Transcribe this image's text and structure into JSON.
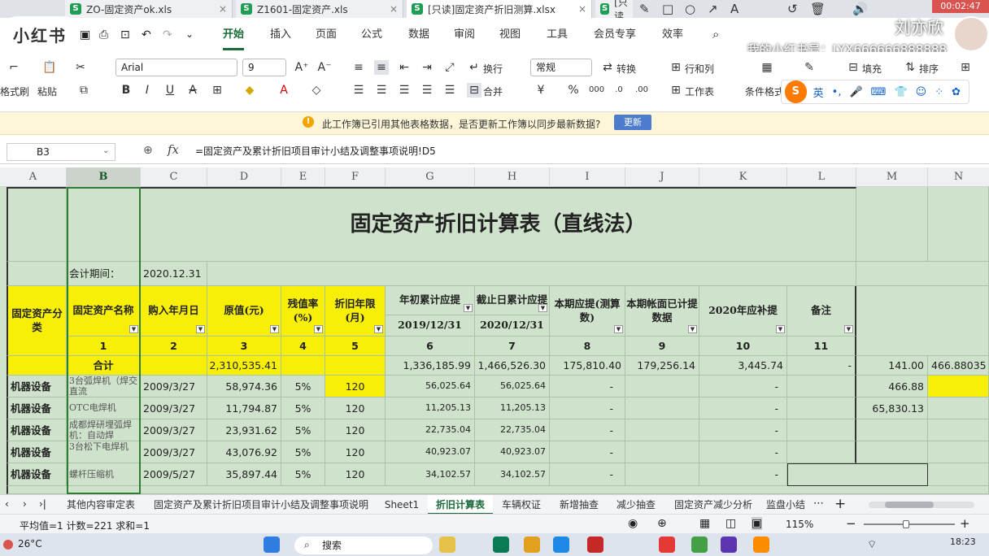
{
  "file_tabs": [
    {
      "label": "ZO-固定资产ok.xls",
      "active": false
    },
    {
      "label": "Z1601-固定资产.xls",
      "active": false
    },
    {
      "label": "[只读]固定资产折旧测算.xlsx",
      "active": true
    },
    {
      "label": "[只读",
      "active": false
    }
  ],
  "record_time": "00:02:47",
  "watermark": {
    "logo": "小红书",
    "name": "刘亦欣",
    "id": "我的小红书号：LYX666666888888"
  },
  "menu_tabs": [
    "开始",
    "插入",
    "页面",
    "公式",
    "数据",
    "审阅",
    "视图",
    "工具",
    "会员专享",
    "效率"
  ],
  "toolbar": {
    "format_painter": "格式刷",
    "paste": "粘贴",
    "font_name": "Arial",
    "font_size": "9",
    "wrap": "换行",
    "number_format": "常规",
    "convert": "转换",
    "rowcol": "行和列",
    "fill": "填充",
    "sort": "排序",
    "merge": "合并",
    "worksheet": "工作表",
    "cond_format": "条件格式",
    "ime": "英"
  },
  "notice": {
    "text": "此工作簿已引用其他表格数据，是否更新工作簿以同步最新数据?",
    "button": "更新"
  },
  "formula_bar": {
    "name_box": "B3",
    "formula": "=固定资产及累计折旧项目审计小结及调整事项说明!D5"
  },
  "columns": [
    "A",
    "B",
    "C",
    "D",
    "E",
    "F",
    "G",
    "H",
    "I",
    "J",
    "K",
    "L",
    "M",
    "N"
  ],
  "sheet": {
    "title": "固定资产折旧计算表（直线法）",
    "period_label": "会计期间：",
    "period_value": "2020.12.31",
    "headers": {
      "a": "固定资产分类",
      "b": "固定资产名称",
      "c": "购入年月日",
      "d": "原值(元)",
      "e": "残值率(%)",
      "f": "折旧年限(月)",
      "g": "年初累计应提",
      "g_date": "2019/12/31",
      "h": "截止日累计应提",
      "h_date": "2020/12/31",
      "i": "本期应提(测算数)",
      "j": "本期帐面已计提数据",
      "k": "2020年应补提",
      "l": "备注"
    },
    "header_nums": [
      "1",
      "2",
      "3",
      "4",
      "5",
      "6",
      "7",
      "8",
      "9",
      "10",
      "11"
    ],
    "total_row": {
      "label": "合计",
      "d": "2,310,535.41",
      "g": "1,336,185.99",
      "h": "1,466,526.30",
      "i": "175,810.40",
      "j": "179,256.14",
      "k": "3,445.74",
      "l": "-",
      "m": "141.00",
      "n": "466.88035"
    },
    "rows": [
      {
        "a": "机器设备",
        "b": "3台弧焊机（焊交直流",
        "c": "2009/3/27",
        "d": "58,974.36",
        "e": "5%",
        "f": "120",
        "g": "56,025.64",
        "h": "56,025.64",
        "i": "-",
        "k": "-",
        "m": "466.88"
      },
      {
        "a": "机器设备",
        "b": "OTC电焊机",
        "c": "2009/3/27",
        "d": "11,794.87",
        "e": "5%",
        "f": "120",
        "g": "11,205.13",
        "h": "11,205.13",
        "i": "-",
        "k": "-",
        "m": "65,830.13"
      },
      {
        "a": "机器设备",
        "b": "成都焊研埋弧焊机：自动焊",
        "c": "2009/3/27",
        "d": "23,931.62",
        "e": "5%",
        "f": "120",
        "g": "22,735.04",
        "h": "22,735.04",
        "i": "-",
        "k": "-",
        "m": ""
      },
      {
        "a": "机器设备",
        "b": "3台松下电焊机",
        "c": "2009/3/27",
        "d": "43,076.92",
        "e": "5%",
        "f": "120",
        "g": "40,923.07",
        "h": "40,923.07",
        "i": "-",
        "k": "-",
        "m": ""
      },
      {
        "a": "机器设备",
        "b": "螺杆压缩机",
        "c": "2009/5/27",
        "d": "35,897.44",
        "e": "5%",
        "f": "120",
        "g": "34,102.57",
        "h": "34,102.57",
        "i": "-",
        "k": "-",
        "m": ""
      }
    ]
  },
  "sheet_tabs": [
    {
      "label": "其他内容审定表",
      "active": false
    },
    {
      "label": "固定资产及累计折旧项目审计小结及调整事项说明",
      "active": false
    },
    {
      "label": "Sheet1",
      "active": false
    },
    {
      "label": "折旧计算表",
      "active": true
    },
    {
      "label": "车辆权证",
      "active": false
    },
    {
      "label": "新增抽查",
      "active": false
    },
    {
      "label": "减少抽查",
      "active": false
    },
    {
      "label": "固定资产减少分析",
      "active": false
    },
    {
      "label": "监盘小结",
      "active": false
    }
  ],
  "status": {
    "summary": "平均值=1  计数=221  求和=1",
    "zoom": "115%"
  },
  "taskbar": {
    "weather": "26°C",
    "search": "搜索",
    "time": "18:23"
  }
}
